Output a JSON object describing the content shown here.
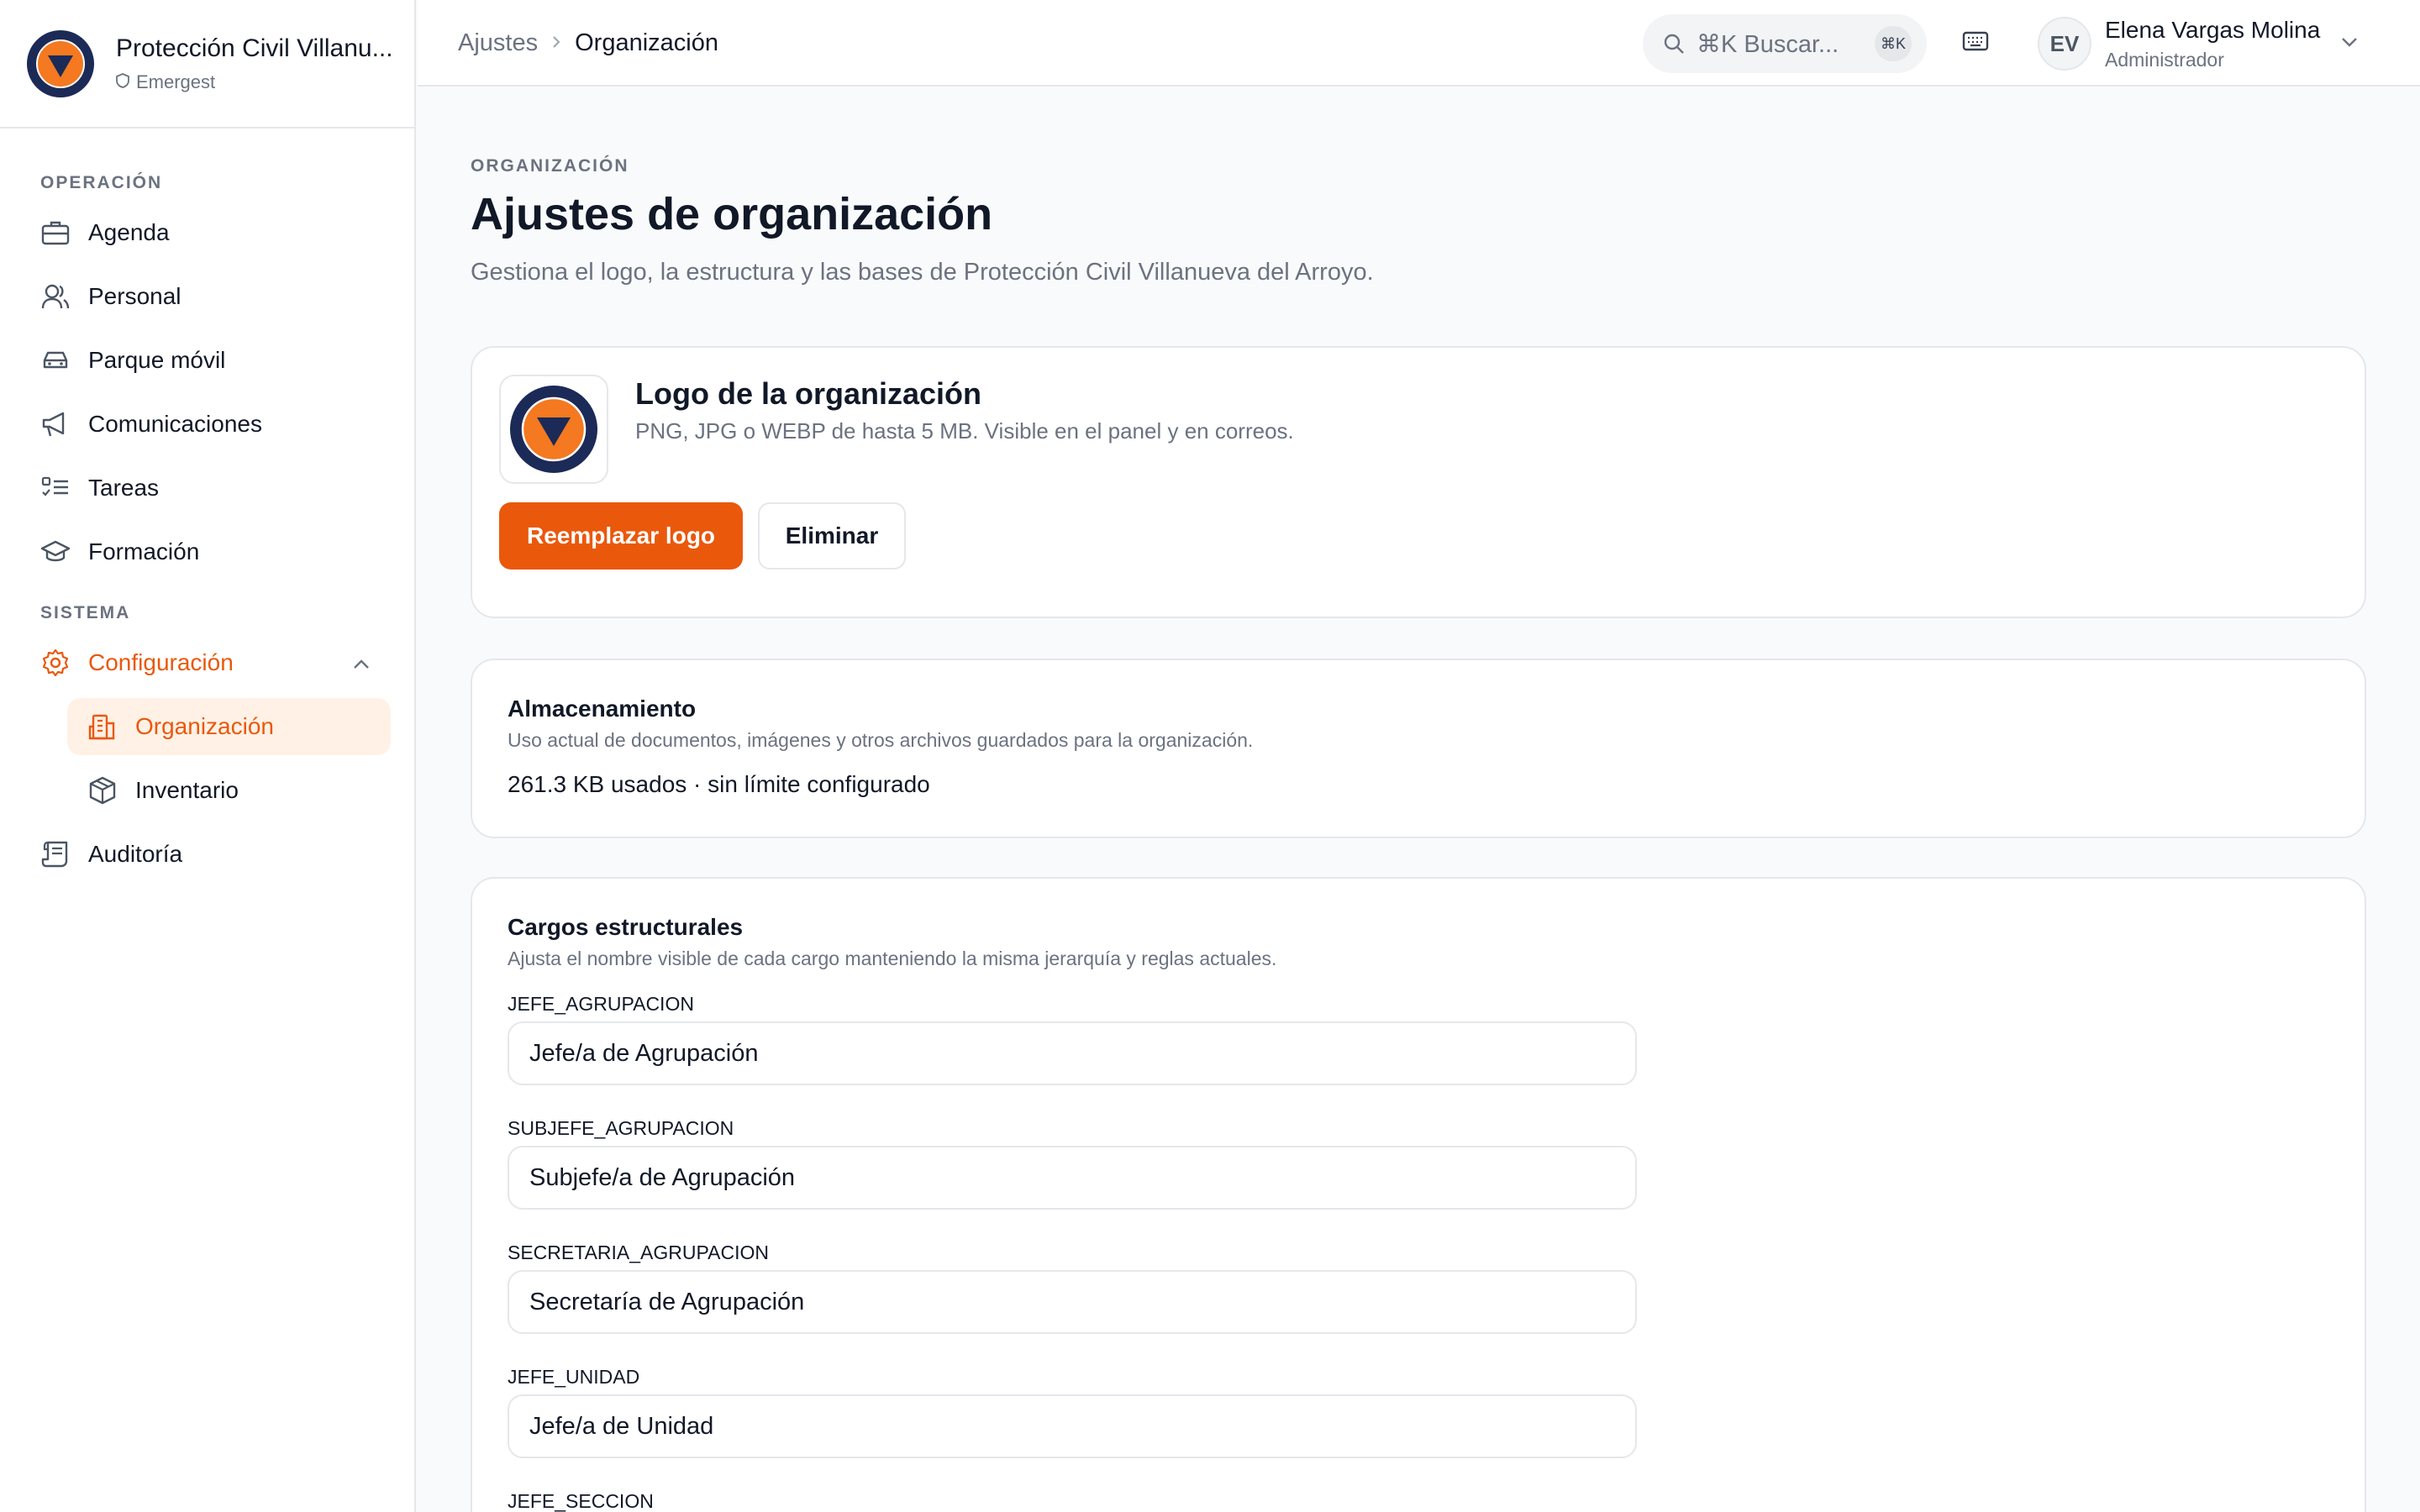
{
  "org": {
    "name": "Protección Civil Villanu...",
    "product": "Emergest"
  },
  "sidebar": {
    "section_operacion": "OPERACIÓN",
    "section_sistema": "SISTEMA",
    "items": [
      {
        "label": "Agenda",
        "icon": "briefcase-icon"
      },
      {
        "label": "Personal",
        "icon": "users-icon"
      },
      {
        "label": "Parque móvil",
        "icon": "car-icon"
      },
      {
        "label": "Comunicaciones",
        "icon": "megaphone-icon"
      },
      {
        "label": "Tareas",
        "icon": "checklist-icon"
      },
      {
        "label": "Formación",
        "icon": "graduation-cap-icon"
      }
    ],
    "config": {
      "label": "Configuración",
      "icon": "gear-icon"
    },
    "config_children": [
      {
        "label": "Organización",
        "icon": "building-icon"
      },
      {
        "label": "Inventario",
        "icon": "package-icon"
      }
    ],
    "audit": {
      "label": "Auditoría",
      "icon": "scroll-icon"
    }
  },
  "topbar": {
    "breadcrumb_parent": "Ajustes",
    "breadcrumb_current": "Organización",
    "search_placeholder": "⌘K Buscar...",
    "search_kbd": "⌘K",
    "user_initials": "EV",
    "user_name": "Elena Vargas Molina",
    "user_role": "Administrador"
  },
  "page": {
    "eyebrow": "ORGANIZACIÓN",
    "title": "Ajustes de organización",
    "description": "Gestiona el logo, la estructura y las bases de Protección Civil Villanueva del Arroyo."
  },
  "logo_card": {
    "title": "Logo de la organización",
    "description": "PNG, JPG o WEBP de hasta 5 MB. Visible en el panel y en correos.",
    "replace_label": "Reemplazar logo",
    "delete_label": "Eliminar"
  },
  "storage_card": {
    "title": "Almacenamiento",
    "description": "Uso actual de documentos, imágenes y otros archivos guardados para la organización.",
    "value": "261.3 KB usados · sin límite configurado"
  },
  "roles_card": {
    "title": "Cargos estructurales",
    "description": "Ajusta el nombre visible de cada cargo manteniendo la misma jerarquía y reglas actuales.",
    "fields": [
      {
        "key": "JEFE_AGRUPACION",
        "value": "Jefe/a de Agrupación"
      },
      {
        "key": "SUBJEFE_AGRUPACION",
        "value": "Subjefe/a de Agrupación"
      },
      {
        "key": "SECRETARIA_AGRUPACION",
        "value": "Secretaría de Agrupación"
      },
      {
        "key": "JEFE_UNIDAD",
        "value": "Jefe/a de Unidad"
      },
      {
        "key": "JEFE_SECCION",
        "value": ""
      }
    ]
  },
  "colors": {
    "accent": "#ea580c",
    "accent_soft": "#fff1e6",
    "logo_navy": "#1b2a57",
    "logo_orange": "#f47920"
  }
}
